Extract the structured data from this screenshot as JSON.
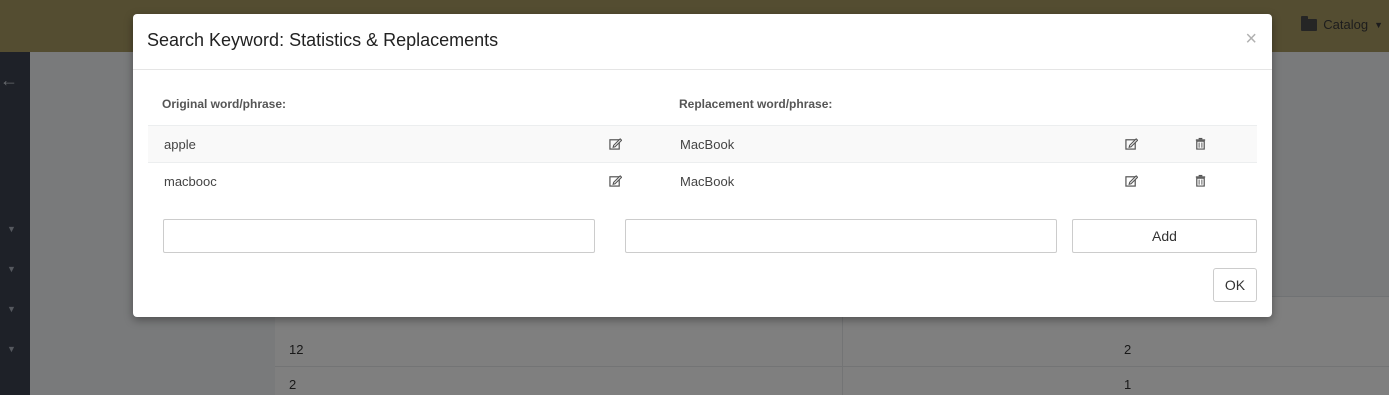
{
  "background": {
    "topbar": {
      "catalog_label": "Catalog",
      "catalog_icon": "folder-icon"
    },
    "table_rows": [
      {
        "left": "12",
        "right": "2"
      },
      {
        "left": "2",
        "right": "1"
      }
    ]
  },
  "modal": {
    "title": "Search Keyword: Statistics & Replacements",
    "close_label": "×",
    "original_header": "Original word/phrase:",
    "replacement_header": "Replacement word/phrase:",
    "rows": [
      {
        "original": "apple",
        "replacement": "MacBook"
      },
      {
        "original": "macbooc",
        "replacement": "MacBook"
      }
    ],
    "original_input": {
      "value": "",
      "placeholder": ""
    },
    "replacement_input": {
      "value": "",
      "placeholder": ""
    },
    "add_label": "Add",
    "ok_label": "OK"
  },
  "colors": {
    "topbar": "#a89a63",
    "sidebar": "#3c4350",
    "overlay": "rgba(0,0,0,0.5)"
  }
}
